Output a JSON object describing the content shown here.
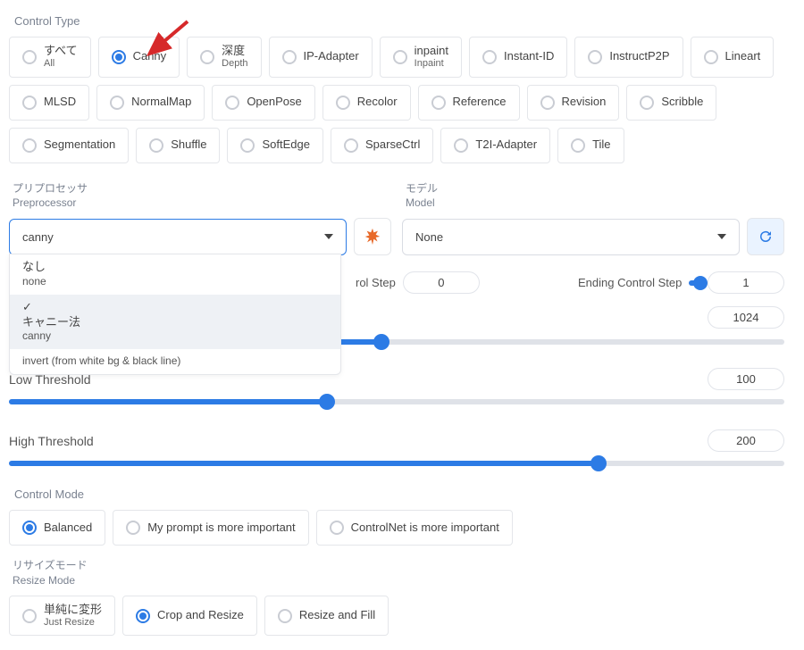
{
  "sections": {
    "control_type_label": "Control Type",
    "preprocessor_jp": "プリプロセッサ",
    "preprocessor_en": "Preprocessor",
    "model_jp": "モデル",
    "model_en": "Model",
    "control_mode_label": "Control Mode",
    "resize_mode_jp": "リサイズモード",
    "resize_mode_en": "Resize Mode"
  },
  "control_types": [
    {
      "main": "すべて",
      "sub": "All"
    },
    {
      "main": "Canny",
      "selected": true
    },
    {
      "main": "深度",
      "sub": "Depth"
    },
    {
      "main": "IP-Adapter"
    },
    {
      "main": "inpaint",
      "sub": "Inpaint"
    },
    {
      "main": "Instant-ID"
    },
    {
      "main": "InstructP2P"
    },
    {
      "main": "Lineart"
    },
    {
      "main": "MLSD"
    },
    {
      "main": "NormalMap"
    },
    {
      "main": "OpenPose"
    },
    {
      "main": "Recolor"
    },
    {
      "main": "Reference"
    },
    {
      "main": "Revision"
    },
    {
      "main": "Scribble"
    },
    {
      "main": "Segmentation"
    },
    {
      "main": "Shuffle"
    },
    {
      "main": "SoftEdge"
    },
    {
      "main": "SparseCtrl"
    },
    {
      "main": "T2I-Adapter"
    },
    {
      "main": "Tile"
    }
  ],
  "preprocessor": {
    "value": "canny",
    "options": [
      {
        "jp": "なし",
        "en": "none"
      },
      {
        "jp": "キャニー法",
        "en": "canny",
        "active": true,
        "checked": true
      },
      {
        "jp": "",
        "en": "invert (from white bg & black line)"
      }
    ]
  },
  "model": {
    "value": "None"
  },
  "triple": {
    "control_step_label": "rol Step",
    "ending_label": "Ending Control Step",
    "weight_value": "0",
    "ending_value": "1"
  },
  "sliders": {
    "res_value": "1024",
    "low_label": "Low Threshold",
    "low_value": "100",
    "high_label": "High Threshold",
    "high_value": "200"
  },
  "control_modes": [
    {
      "label": "Balanced",
      "selected": true
    },
    {
      "label": "My prompt is more important"
    },
    {
      "label": "ControlNet is more important"
    }
  ],
  "resize_modes": [
    {
      "jp": "単純に変形",
      "en": "Just Resize"
    },
    {
      "label": "Crop and Resize",
      "selected": true
    },
    {
      "label": "Resize and Fill"
    }
  ],
  "colors": {
    "accent": "#2c7be5"
  }
}
